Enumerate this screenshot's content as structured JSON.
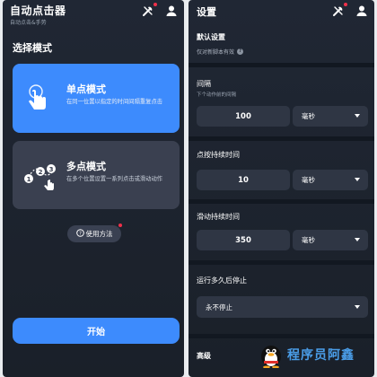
{
  "left": {
    "app_title": "自动点击器",
    "app_subtitle": "自动点击&手势",
    "section_title": "选择模式",
    "modes": [
      {
        "title": "单点模式",
        "description": "在同一位置以指定的时间间隔重复点击",
        "selected": true
      },
      {
        "title": "多点模式",
        "description": "在多个位置设置一系列点击或滑动动作",
        "selected": false
      }
    ],
    "usage_button": "使用方法",
    "start_button": "开始"
  },
  "right": {
    "title": "设置",
    "group_title": "默认设置",
    "group_note": "仅对新脚本有效",
    "interval": {
      "label": "间隔",
      "sublabel": "下个动作前的间隔",
      "value": "100",
      "unit": "毫秒"
    },
    "click_duration": {
      "label": "点按持续时间",
      "value": "10",
      "unit": "毫秒"
    },
    "swipe_duration": {
      "label": "滑动持续时间",
      "value": "350",
      "unit": "毫秒"
    },
    "stop_after": {
      "label": "运行多久后停止",
      "value": "永不停止"
    },
    "advanced_label": "高级"
  },
  "watermark": "程序员阿鑫",
  "colors": {
    "accent": "#3d8bfd",
    "background": "#1e2430",
    "card": "#3a4050",
    "badge": "#f0304a"
  },
  "icons": [
    "wrench-screwdriver-icon",
    "person-icon",
    "tap-finger-icon",
    "multi-point-path-icon",
    "help-icon",
    "chevron-down-icon"
  ]
}
